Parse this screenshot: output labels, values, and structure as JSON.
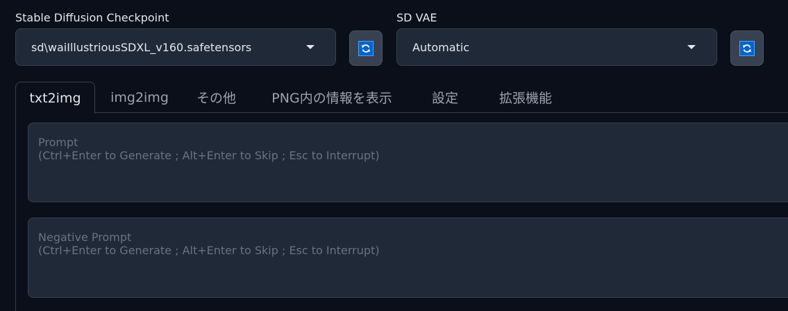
{
  "checkpoint": {
    "label": "Stable Diffusion Checkpoint",
    "value": "sd\\waiIllustriousSDXL_v160.safetensors",
    "refresh_icon": "refresh-icon"
  },
  "vae": {
    "label": "SD VAE",
    "value": "Automatic",
    "refresh_icon": "refresh-icon"
  },
  "tabs": [
    {
      "label": "txt2img",
      "active": true
    },
    {
      "label": "img2img",
      "active": false
    },
    {
      "label": "その他",
      "active": false
    },
    {
      "label": "PNG内の情報を表示",
      "active": false
    },
    {
      "label": "設定",
      "active": false
    },
    {
      "label": "拡張機能",
      "active": false
    }
  ],
  "prompt": {
    "placeholder_title": "Prompt",
    "placeholder_hint": "(Ctrl+Enter to Generate ; Alt+Enter to Skip ; Esc to Interrupt)"
  },
  "negative_prompt": {
    "placeholder_title": "Negative Prompt",
    "placeholder_hint": "(Ctrl+Enter to Generate ; Alt+Enter to Skip ; Esc to Interrupt)"
  },
  "colors": {
    "background": "#0b0f19",
    "input_bg": "#1f2937",
    "border": "#374151",
    "refresh_blue": "#0a64c8"
  }
}
